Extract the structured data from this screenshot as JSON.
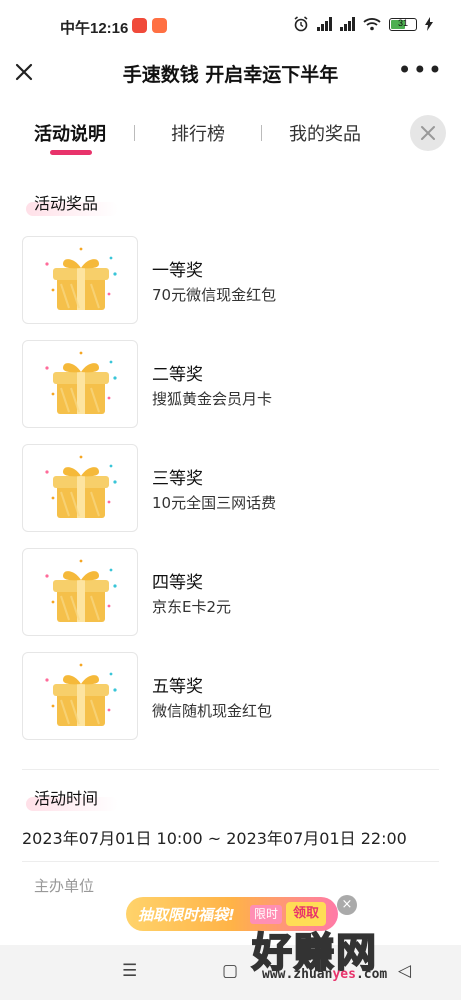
{
  "status_bar": {
    "time": "中午12:16",
    "battery_level": "31"
  },
  "nav": {
    "title": "手速数钱 开启幸运下半年"
  },
  "tabs": [
    {
      "label": "活动说明"
    },
    {
      "label": "排行榜"
    },
    {
      "label": "我的奖品"
    }
  ],
  "prizes_section": {
    "label": "活动奖品",
    "items": [
      {
        "name": "一等奖",
        "desc": "70元微信现金红包"
      },
      {
        "name": "二等奖",
        "desc": "搜狐黄金会员月卡"
      },
      {
        "name": "三等奖",
        "desc": "10元全国三网话费"
      },
      {
        "name": "四等奖",
        "desc": "京东E卡2元"
      },
      {
        "name": "五等奖",
        "desc": "微信随机现金红包"
      }
    ]
  },
  "time_section": {
    "label": "活动时间",
    "value": "2023年07月01日 10:00 ~ 2023年07月01日 22:00"
  },
  "organizer": {
    "label": "主办单位"
  },
  "banner": {
    "text": "抽取限时福袋!",
    "tag": "限时",
    "claim": "领取"
  },
  "watermark": {
    "big": "好赚网",
    "url_a": "www.zhuan",
    "url_b": "yes",
    "url_c": ".com"
  },
  "colors": {
    "accent": "#e8336b",
    "gift": "#f5c04a"
  }
}
